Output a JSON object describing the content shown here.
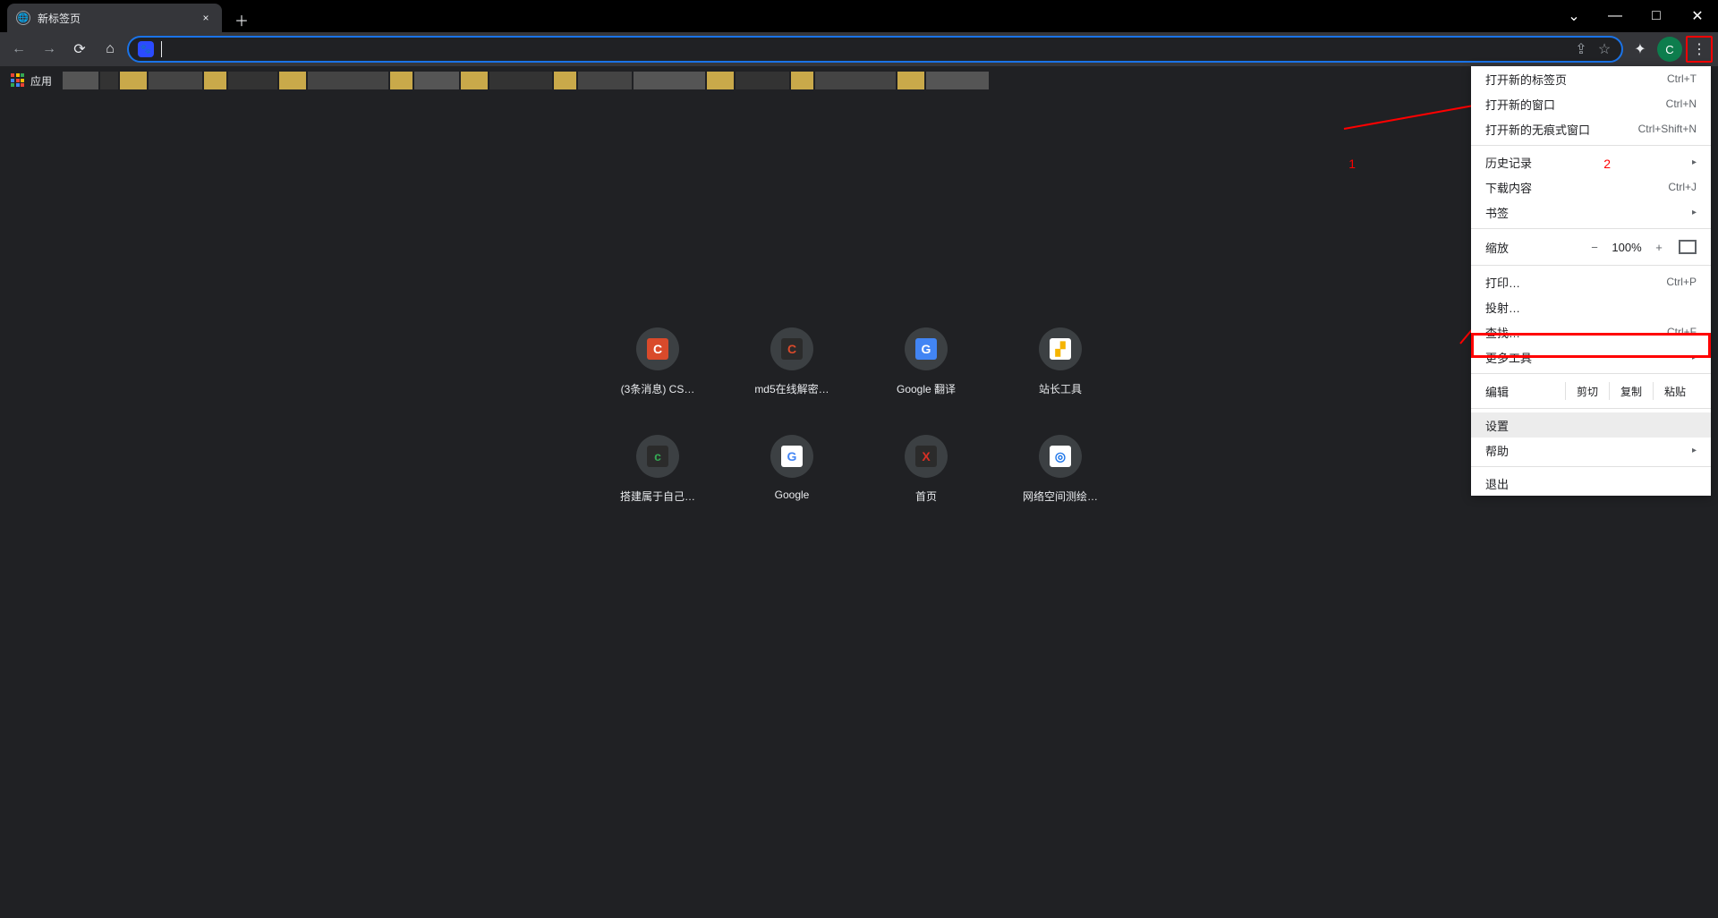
{
  "tab": {
    "title": "新标签页",
    "close": "×"
  },
  "newtab_plus": "＋",
  "win": {
    "down": "⌄",
    "min": "—",
    "max": "□",
    "close": "✕"
  },
  "omnibox": {
    "site_icon": "🐾"
  },
  "profile_letter": "C",
  "bookmarks_label": "应用",
  "shortcuts": [
    {
      "label": "(3条消息) CS…",
      "bg": "#d94a2b",
      "txt": "C"
    },
    {
      "label": "md5在线解密…",
      "bg": "#2b2b2b",
      "txt": "C",
      "txtcolor": "#d94a2b"
    },
    {
      "label": "Google 翻译",
      "bg": "#4285f4",
      "txt": "G"
    },
    {
      "label": "站长工具",
      "bg": "#ffffff",
      "txt": "▞",
      "txtcolor": "#f5b400"
    },
    {
      "label": "搭建属于自己…",
      "bg": "#2b2b2b",
      "txt": "c",
      "txtcolor": "#34a853"
    },
    {
      "label": "Google",
      "bg": "#ffffff",
      "txt": "G",
      "txtcolor": "#4285f4"
    },
    {
      "label": "首页",
      "bg": "#2b2b2b",
      "txt": "X",
      "txtcolor": "#d93025"
    },
    {
      "label": "网络空间测绘…",
      "bg": "#ffffff",
      "txt": "◎",
      "txtcolor": "#1a73e8"
    }
  ],
  "menu": {
    "new_tab": {
      "label": "打开新的标签页",
      "key": "Ctrl+T"
    },
    "new_window": {
      "label": "打开新的窗口",
      "key": "Ctrl+N"
    },
    "incognito": {
      "label": "打开新的无痕式窗口",
      "key": "Ctrl+Shift+N"
    },
    "history": {
      "label": "历史记录"
    },
    "downloads": {
      "label": "下载内容",
      "key": "Ctrl+J"
    },
    "bookmarks": {
      "label": "书签"
    },
    "zoom": {
      "label": "缩放",
      "minus": "−",
      "value": "100%",
      "plus": "+"
    },
    "print": {
      "label": "打印…",
      "key": "Ctrl+P"
    },
    "cast": {
      "label": "投射…"
    },
    "find": {
      "label": "查找…",
      "key": "Ctrl+F"
    },
    "more_tools": {
      "label": "更多工具"
    },
    "edit": {
      "label": "编辑",
      "cut": "剪切",
      "copy": "复制",
      "paste": "粘贴"
    },
    "settings": {
      "label": "设置"
    },
    "help": {
      "label": "帮助"
    },
    "exit": {
      "label": "退出"
    }
  },
  "annotations": {
    "one": "1",
    "two": "2"
  }
}
